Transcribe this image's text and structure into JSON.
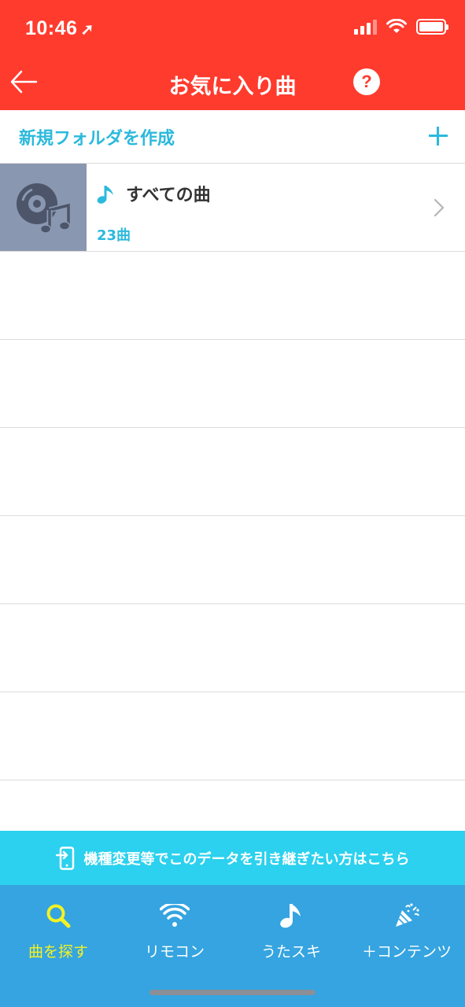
{
  "status_bar": {
    "time": "10:46",
    "location_glyph": "➚"
  },
  "nav": {
    "title": "お気に入り曲",
    "help_label": "?"
  },
  "new_folder": {
    "label": "新規フォルダを作成"
  },
  "folders": [
    {
      "title": "すべての曲",
      "count": "23曲"
    }
  ],
  "empty_rows": 6,
  "transfer_banner": {
    "label": "機種変更等でこのデータを引き継ぎたい方はこちら"
  },
  "tabs": [
    {
      "label": "曲を探す",
      "icon": "search-icon",
      "active": true
    },
    {
      "label": "リモコン",
      "icon": "wifi-icon",
      "active": false
    },
    {
      "label": "うたスキ",
      "icon": "music-note-icon",
      "active": false
    },
    {
      "label": "＋コンテンツ",
      "icon": "party-popper-icon",
      "active": false
    }
  ],
  "colors": {
    "header": "#ff3b2e",
    "accent": "#2bb9dc",
    "banner": "#2bd1ee",
    "tab_bar": "#35a4e0",
    "active_tab": "#f2f225"
  }
}
